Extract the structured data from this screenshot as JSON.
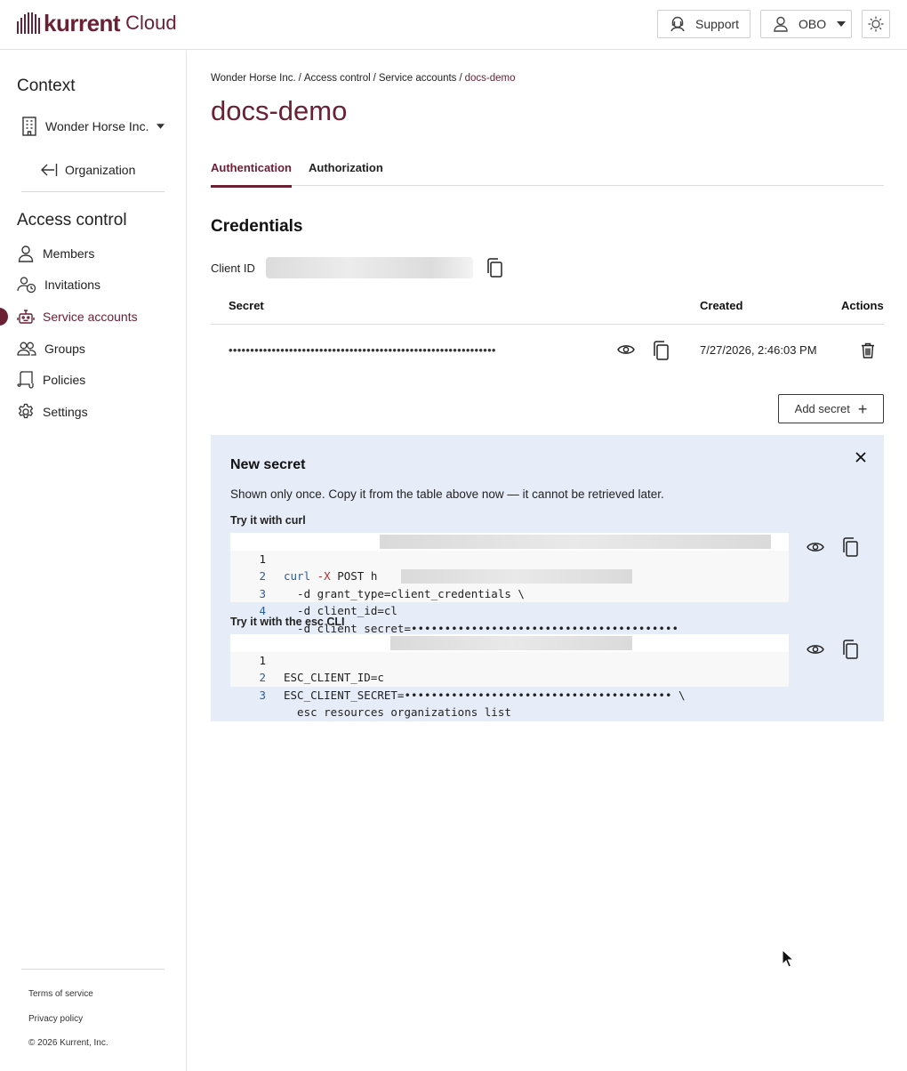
{
  "header": {
    "brand": "kurrent",
    "brand_suffix": "Cloud",
    "support_label": "Support",
    "user_label": "OBO"
  },
  "sidebar": {
    "context_title": "Context",
    "context_value": "Wonder Horse Inc.",
    "org_link": "Organization",
    "section_title": "Access control",
    "items": [
      {
        "label": "Members",
        "icon": "person-icon"
      },
      {
        "label": "Invitations",
        "icon": "person-clock-icon"
      },
      {
        "label": "Service accounts",
        "icon": "robot-icon",
        "active": true
      },
      {
        "label": "Groups",
        "icon": "people-icon"
      },
      {
        "label": "Policies",
        "icon": "scroll-icon"
      },
      {
        "label": "Settings",
        "icon": "gear-icon"
      }
    ],
    "footer": {
      "terms": "Terms of service",
      "privacy": "Privacy policy",
      "copyright": "© 2026 Kurrent, Inc."
    }
  },
  "breadcrumb": [
    "Wonder Horse Inc.",
    "Access control",
    "Service accounts",
    "docs-demo"
  ],
  "page_title": "docs-demo",
  "tabs": [
    "Authentication",
    "Authorization"
  ],
  "credentials": {
    "title": "Credentials",
    "client_id_label": "Client ID",
    "columns": {
      "secret": "Secret",
      "created": "Created",
      "actions": "Actions"
    },
    "rows": [
      {
        "secret_mask": "••••••••••••••••••••••••••••••••••••••••••••••••••••••••••••••",
        "created": "7/27/2026, 2:46:03 PM"
      }
    ],
    "add_secret_label": "Add secret"
  },
  "new_secret": {
    "title": "New secret",
    "description": "Shown only once. Copy it from the table above now — it cannot be retrieved later.",
    "curl_label": "Try it with curl",
    "curl_lines": [
      {
        "n": "1"
      },
      {
        "n": "2",
        "text": "  -d grant_type=client_credentials \\"
      },
      {
        "n": "3",
        "text": "  -d client_id=cl"
      },
      {
        "n": "4",
        "text": "  -d client_secret=••••••••••••••••••••••••••••••••••••••••"
      }
    ],
    "curl_cmd": "curl",
    "curl_flag": "-X",
    "curl_method": "POST",
    "curl_url_start": "h",
    "cli_label": "Try it with the esc CLI",
    "cli_lines": [
      {
        "n": "1",
        "text": "ESC_CLIENT_ID=c"
      },
      {
        "n": "2",
        "text": "ESC_CLIENT_SECRET=•••••••••••••••••••••••••••••••••••••••• \\"
      },
      {
        "n": "3",
        "text": "  esc resources organizations list"
      }
    ]
  },
  "colors": {
    "brand": "#6b2034",
    "panel": "#e6edf8"
  }
}
